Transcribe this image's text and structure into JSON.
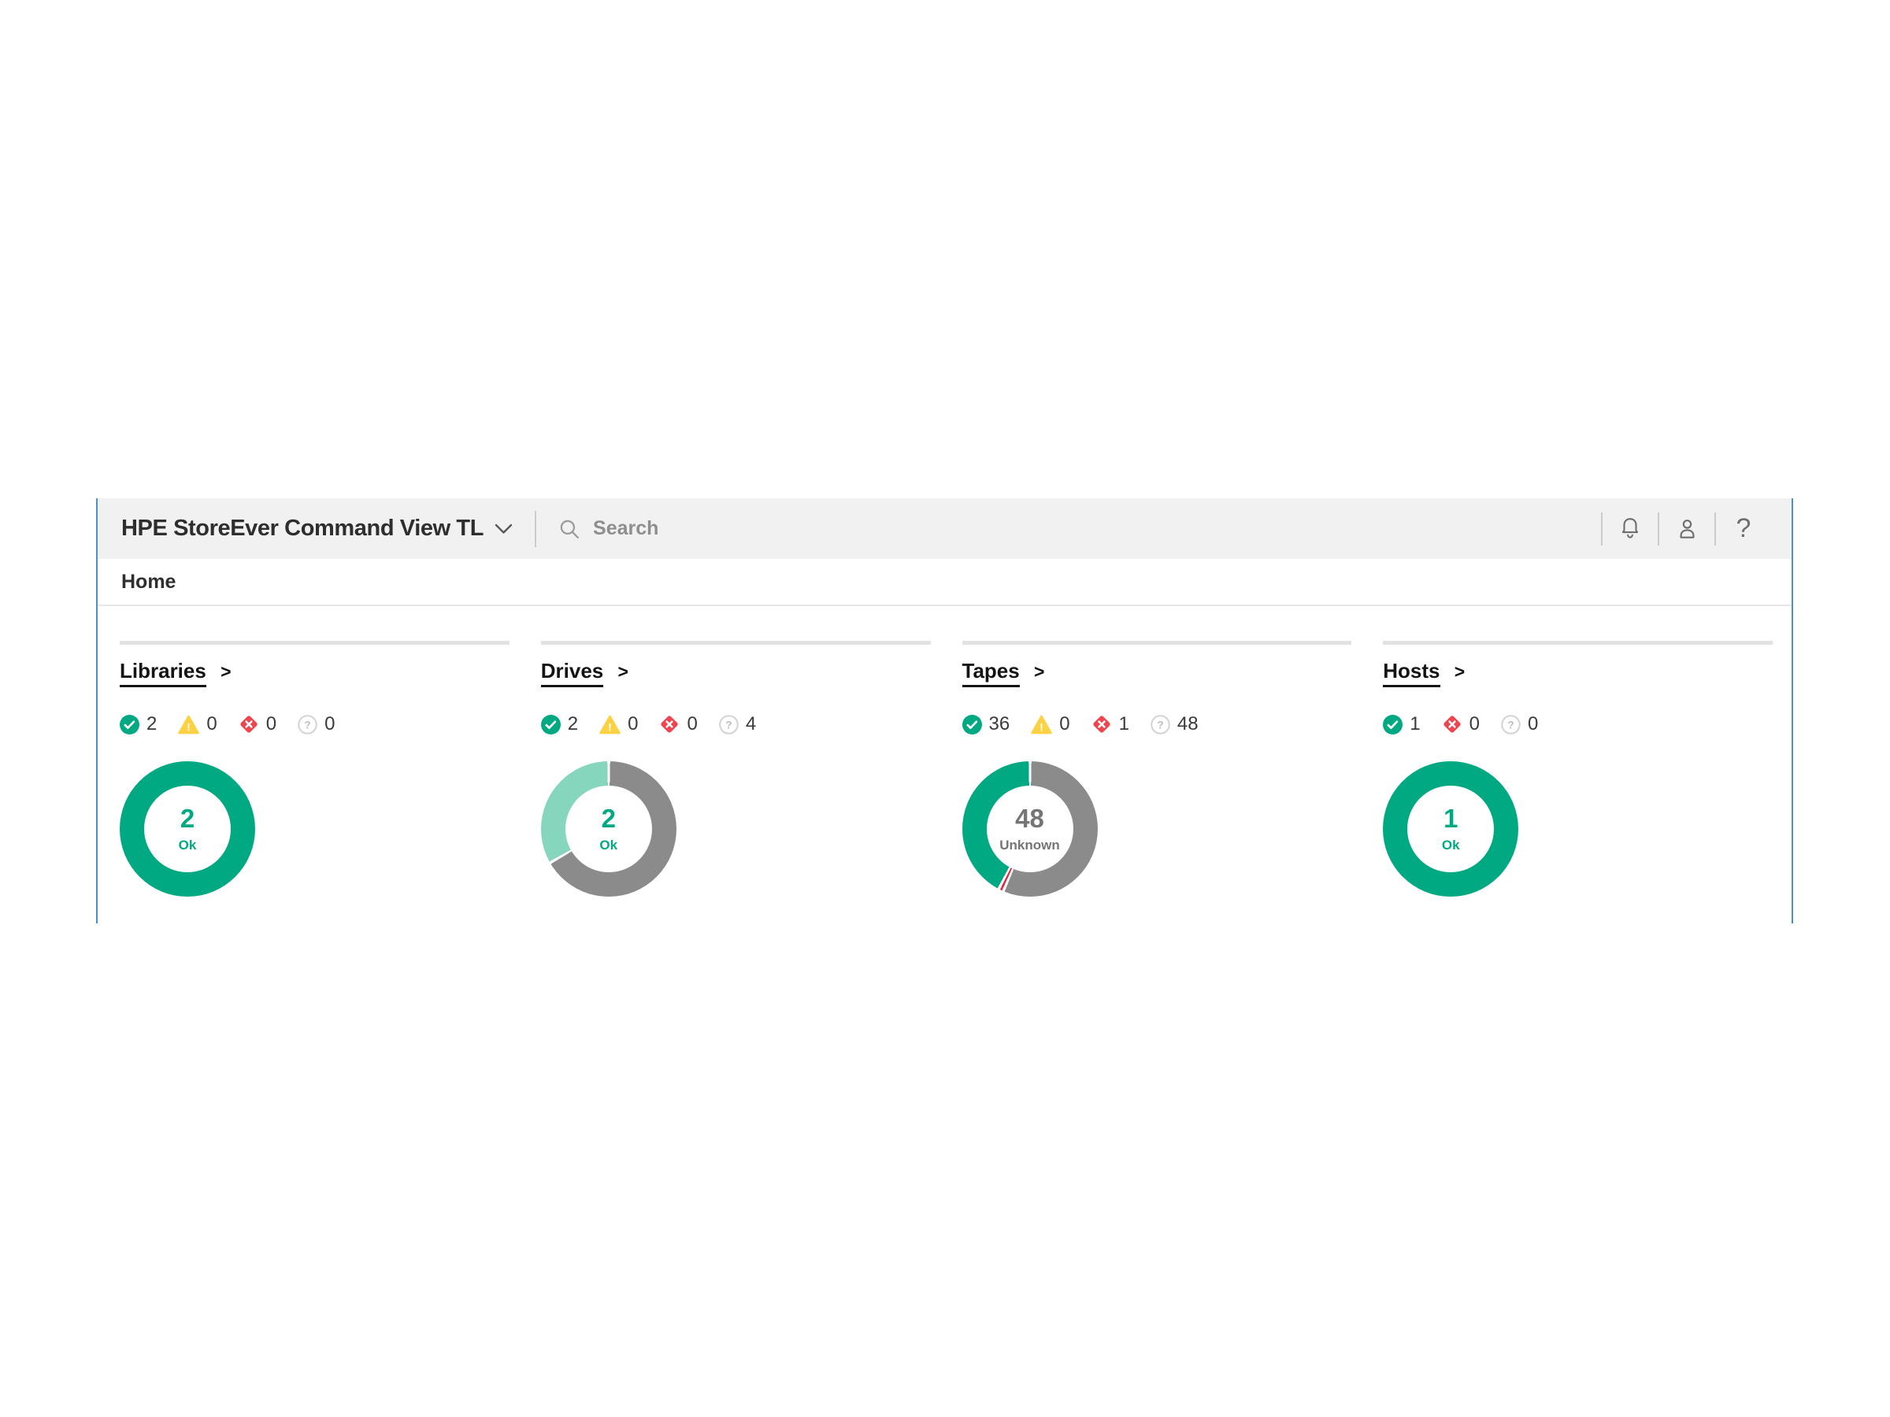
{
  "header": {
    "title": "HPE StoreEver Command View TL",
    "search_placeholder": "Search"
  },
  "breadcrumb": {
    "label": "Home"
  },
  "ui": {
    "link_arrow": ">"
  },
  "colors": {
    "brand_green": "#01a982",
    "ok_light_green": "#85d6bd",
    "unknown_gray": "#8b8b8b",
    "critical_red": "#e8273d",
    "warning_yellow": "#fdd144",
    "header_bg": "#f1f1f1",
    "edge_blue": "#4a90c9",
    "center_unknown_text": "#757575"
  },
  "panels": [
    {
      "title": "Libraries",
      "statuses": {
        "ok": 2,
        "warning": 0,
        "critical": 0,
        "unknown": 0
      },
      "donut": {
        "center_value": "2",
        "center_label": "Ok",
        "segments": [
          {
            "label": "Ok",
            "value": 2,
            "color": "#01a982"
          }
        ]
      }
    },
    {
      "title": "Drives",
      "statuses": {
        "ok": 2,
        "warning": 0,
        "critical": 0,
        "unknown": 4
      },
      "donut": {
        "center_value": "2",
        "center_label": "Ok",
        "segments": [
          {
            "label": "Unknown",
            "value": 4,
            "color": "#8b8b8b"
          },
          {
            "label": "Ok",
            "value": 2,
            "color": "#85d6bd"
          }
        ]
      }
    },
    {
      "title": "Tapes",
      "statuses": {
        "ok": 36,
        "warning": 0,
        "critical": 1,
        "unknown": 48
      },
      "donut": {
        "center_value": "48",
        "center_label": "Unknown",
        "segments": [
          {
            "label": "Unknown",
            "value": 48,
            "color": "#8b8b8b"
          },
          {
            "label": "Critical",
            "value": 1,
            "color": "#e8273d"
          },
          {
            "label": "Ok",
            "value": 36,
            "color": "#01a982"
          }
        ]
      }
    },
    {
      "title": "Hosts",
      "statuses": {
        "ok": 1,
        "critical": 0,
        "unknown": 0
      },
      "donut": {
        "center_value": "1",
        "center_label": "Ok",
        "segments": [
          {
            "label": "Ok",
            "value": 1,
            "color": "#01a982"
          }
        ]
      }
    }
  ],
  "chart_data": [
    {
      "type": "pie",
      "title": "Libraries",
      "labels": [
        "Ok"
      ],
      "values": [
        2
      ],
      "colors": [
        "#01a982"
      ],
      "center_value": "2",
      "center_label": "Ok"
    },
    {
      "type": "pie",
      "title": "Drives",
      "labels": [
        "Unknown",
        "Ok"
      ],
      "values": [
        4,
        2
      ],
      "colors": [
        "#8b8b8b",
        "#85d6bd"
      ],
      "center_value": "2",
      "center_label": "Ok"
    },
    {
      "type": "pie",
      "title": "Tapes",
      "labels": [
        "Unknown",
        "Critical",
        "Ok"
      ],
      "values": [
        48,
        1,
        36
      ],
      "colors": [
        "#8b8b8b",
        "#e8273d",
        "#01a982"
      ],
      "center_value": "48",
      "center_label": "Unknown"
    },
    {
      "type": "pie",
      "title": "Hosts",
      "labels": [
        "Ok"
      ],
      "values": [
        1
      ],
      "colors": [
        "#01a982"
      ],
      "center_value": "1",
      "center_label": "Ok"
    }
  ]
}
